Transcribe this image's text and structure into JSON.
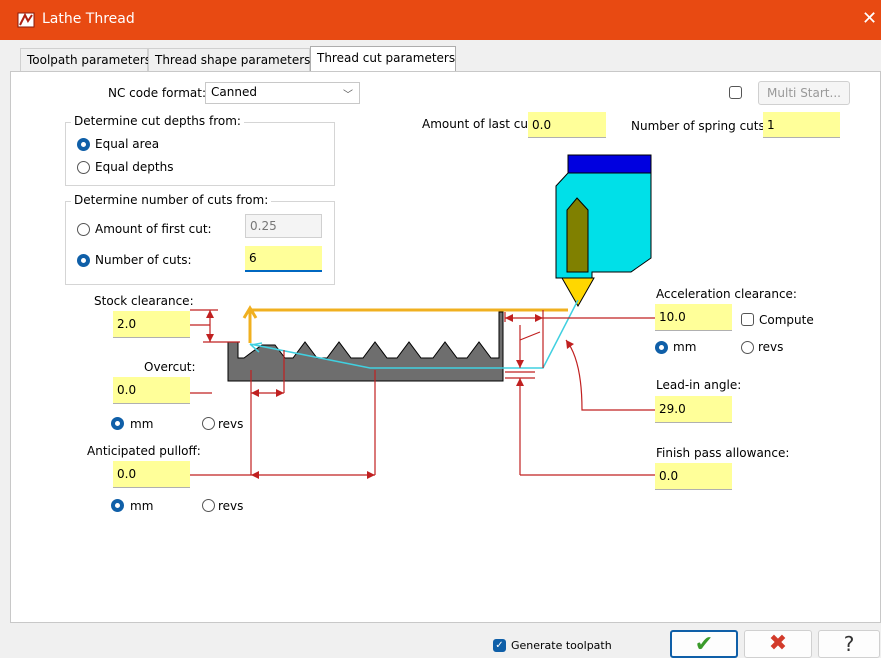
{
  "window": {
    "title": "Lathe Thread",
    "close": "✕"
  },
  "tabs": [
    "Toolpath parameters",
    "Thread shape parameters",
    "Thread cut parameters"
  ],
  "nc_code": {
    "label": "NC code format:",
    "value": "Canned"
  },
  "multi_start": {
    "label": "Multi Start...",
    "checked": false
  },
  "cut_depths": {
    "title": "Determine cut depths from:",
    "options": [
      "Equal area",
      "Equal depths"
    ],
    "selected": "Equal area"
  },
  "num_cuts_group": {
    "title": "Determine number of cuts from:",
    "first_cut_label": "Amount of first cut:",
    "first_cut_value": "0.25",
    "num_cuts_label": "Number of cuts:",
    "num_cuts_value": "6",
    "selected": "Number of cuts:"
  },
  "last_cut": {
    "label": "Amount of last cut:",
    "value": "0.0"
  },
  "spring_cuts": {
    "label": "Number of spring cuts:",
    "value": "1"
  },
  "stock_clearance": {
    "label": "Stock clearance:",
    "value": "2.0"
  },
  "overcut": {
    "label": "Overcut:",
    "value": "0.0",
    "unit_mm": "mm",
    "unit_revs": "revs",
    "selected": "mm"
  },
  "pulloff": {
    "label": "Anticipated pulloff:",
    "value": "0.0",
    "unit_mm": "mm",
    "unit_revs": "revs",
    "selected": "mm"
  },
  "accel_clearance": {
    "label": "Acceleration clearance:",
    "value": "10.0",
    "compute_label": "Compute",
    "compute_checked": false,
    "unit_mm": "mm",
    "unit_revs": "revs",
    "selected": "mm"
  },
  "leadin": {
    "label": "Lead-in angle:",
    "value": "29.0"
  },
  "finish_pass": {
    "label": "Finish pass allowance:",
    "value": "0.0"
  },
  "bottom": {
    "generate_label": "Generate toolpath",
    "generate_checked": true,
    "ok": "✔",
    "cancel": "✖",
    "help": "?"
  },
  "colors": {
    "title": "#e84a12",
    "field": "#ffff99",
    "radio": "#0f5fa8",
    "ok": "#3a9a2a",
    "cancel": "#d23a2a"
  }
}
